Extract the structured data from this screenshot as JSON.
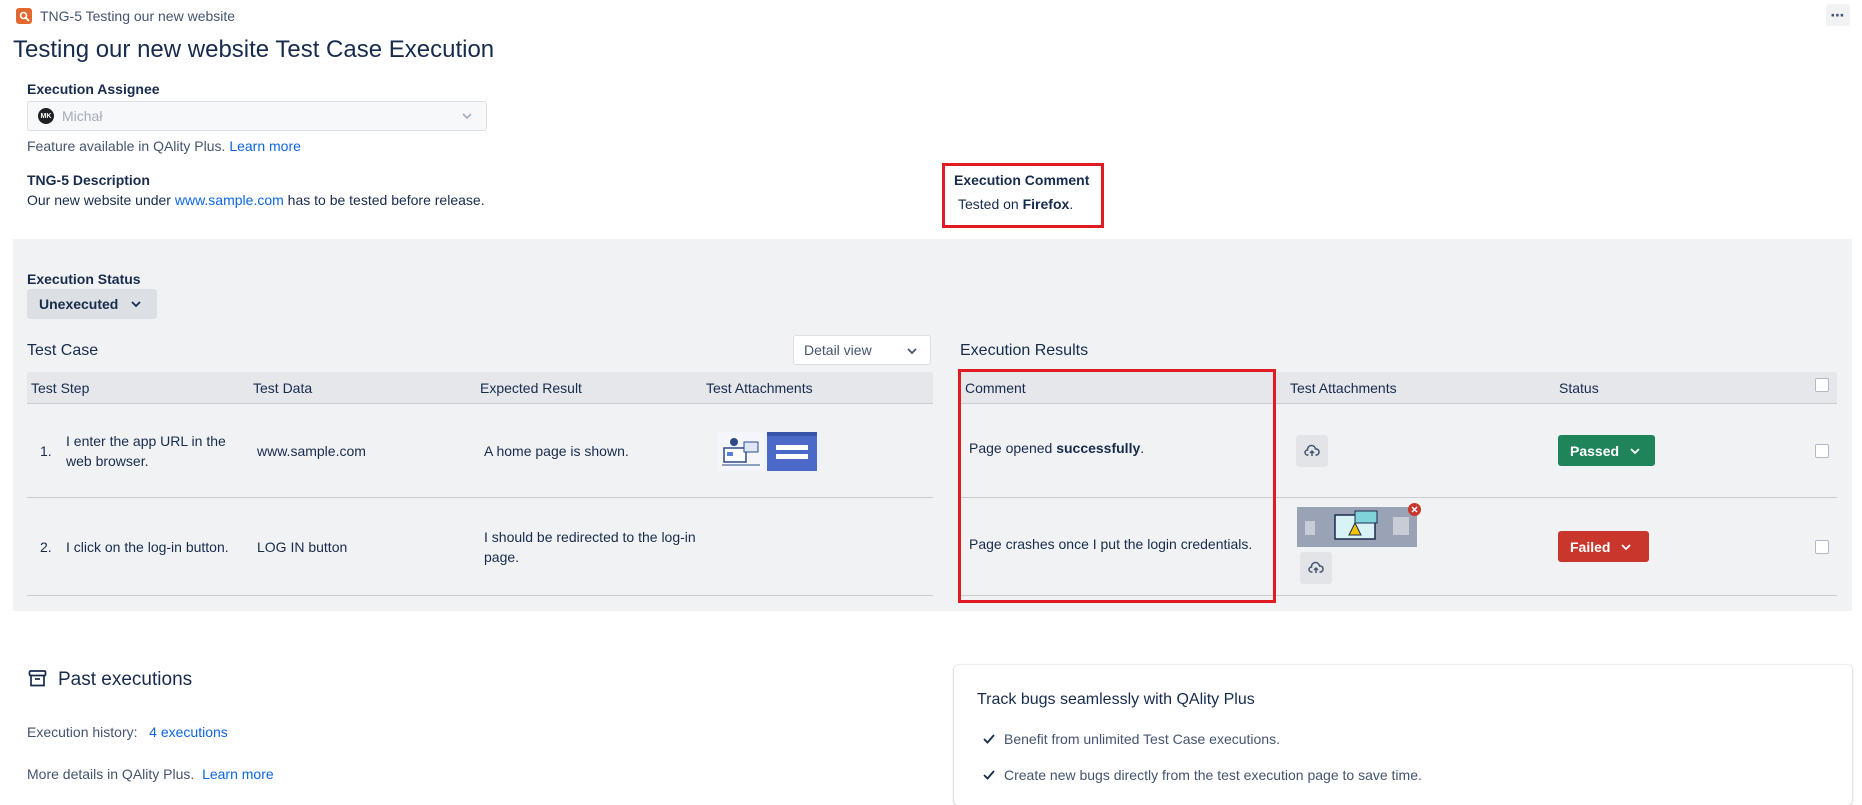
{
  "header": {
    "issue_key_text": "TNG-5 Testing our new website",
    "more_label": "⋯"
  },
  "page": {
    "title": "Testing our new website Test Case Execution"
  },
  "assignee": {
    "label": "Execution Assignee",
    "avatar_initials": "MK",
    "value": "Michał",
    "feature_note": "Feature available in QAlity Plus.",
    "learn_more": "Learn more"
  },
  "description": {
    "label": "TNG-5 Description",
    "text_before": "Our new website under",
    "link": "www.sample.com",
    "text_after": "has to be tested before release."
  },
  "execution_comment": {
    "label": "Execution Comment",
    "text_before": "Tested on",
    "bold": "Firefox",
    "text_after": "."
  },
  "execution_status": {
    "label": "Execution Status",
    "value": "Unexecuted"
  },
  "test_case": {
    "heading": "Test Case",
    "view_select": "Detail view",
    "columns": [
      "Test Step",
      "Test Data",
      "Expected Result",
      "Test Attachments"
    ],
    "rows": [
      {
        "num": "1.",
        "step": "I enter the app URL in the web browser.",
        "data": "www.sample.com",
        "expected": "A home page is shown."
      },
      {
        "num": "2.",
        "step": "I click on the log-in button.",
        "data": "LOG IN button",
        "expected": "I should be redirected to the log-in page."
      }
    ]
  },
  "execution_results": {
    "heading": "Execution Results",
    "columns": [
      "Comment",
      "Test Attachments",
      "Status"
    ],
    "rows": [
      {
        "comment_before": "Page opened",
        "comment_bold": "successfully",
        "comment_after": ".",
        "status": "Passed"
      },
      {
        "comment_before": "Page crashes once I put the login credentials.",
        "comment_bold": "",
        "comment_after": "",
        "status": "Failed"
      }
    ]
  },
  "past_executions": {
    "heading": "Past executions",
    "history_label": "Execution history:",
    "history_link": "4 executions",
    "details_label": "More details in QAlity Plus.",
    "details_link": "Learn more"
  },
  "promo": {
    "title": "Track bugs seamlessly with QAlity Plus",
    "items": [
      "Benefit from unlimited Test Case executions.",
      "Create new bugs directly from the test execution page to save time."
    ]
  },
  "colors": {
    "passed": "#1f845a",
    "failed": "#c9372c",
    "highlight": "#e01b24",
    "link": "#0c66e4"
  }
}
